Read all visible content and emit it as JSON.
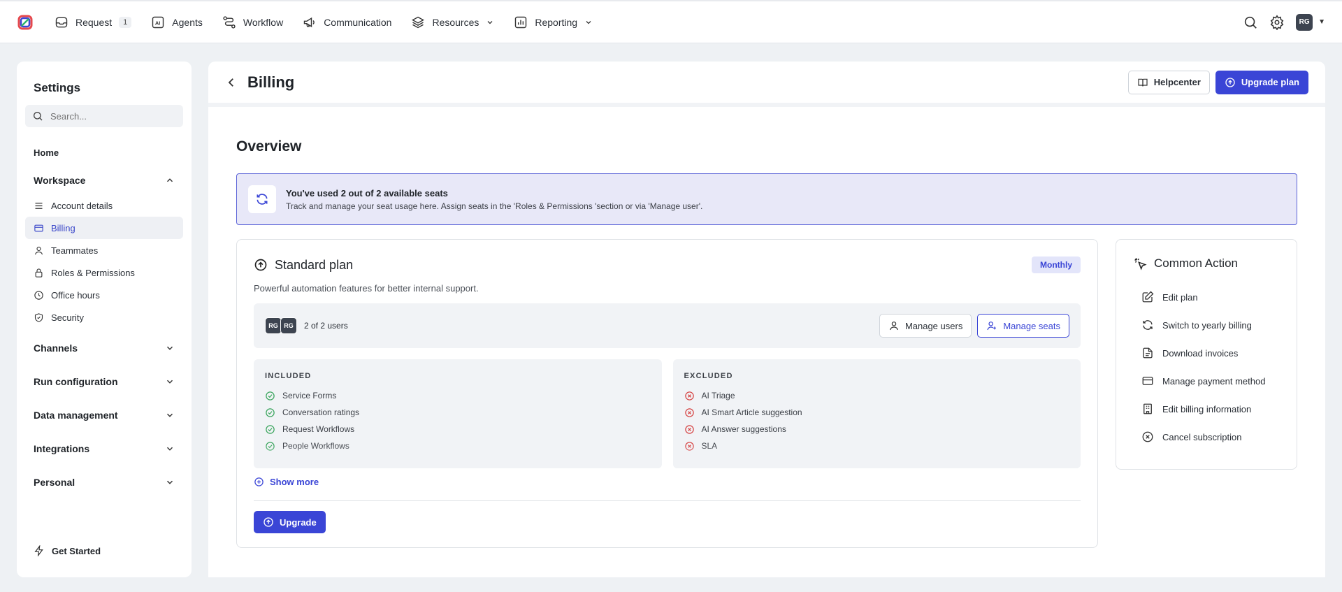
{
  "nav": {
    "items": [
      {
        "label": "Request",
        "icon": "inbox-icon",
        "badge": "1"
      },
      {
        "label": "Agents",
        "icon": "ai-icon"
      },
      {
        "label": "Workflow",
        "icon": "workflow-icon"
      },
      {
        "label": "Communication",
        "icon": "megaphone-icon"
      },
      {
        "label": "Resources",
        "icon": "layers-icon"
      },
      {
        "label": "Reporting",
        "icon": "chart-icon"
      }
    ],
    "avatar_initials": "RG"
  },
  "sidebar": {
    "title": "Settings",
    "search_placeholder": "Search...",
    "home_label": "Home",
    "workspace": {
      "label": "Workspace",
      "items": [
        {
          "label": "Account details",
          "icon": "list-icon"
        },
        {
          "label": "Billing",
          "icon": "credit-card-icon",
          "active": true
        },
        {
          "label": "Teammates",
          "icon": "user-icon"
        },
        {
          "label": "Roles & Permissions",
          "icon": "lock-icon"
        },
        {
          "label": "Office hours",
          "icon": "clock-icon"
        },
        {
          "label": "Security",
          "icon": "shield-icon"
        }
      ]
    },
    "sections": [
      "Channels",
      "Run configuration",
      "Data management",
      "Integrations",
      "Personal"
    ],
    "footer_label": "Get Started"
  },
  "header": {
    "title": "Billing",
    "helpcenter_label": "Helpcenter",
    "upgrade_plan_label": "Upgrade plan"
  },
  "overview": {
    "title": "Overview",
    "banner_title": "You've used 2 out of 2 available seats",
    "banner_desc": "Track and manage your seat usage here. Assign seats in the 'Roles & Permissions 'section or via 'Manage user'."
  },
  "plan": {
    "name": "Standard plan",
    "billing_cycle": "Monthly",
    "description": "Powerful automation features for better internal support.",
    "avatars": [
      "RG",
      "RG"
    ],
    "users_count": "2 of 2 users",
    "manage_users_label": "Manage users",
    "manage_seats_label": "Manage seats",
    "included_label": "INCLUDED",
    "included": [
      "Service Forms",
      "Conversation ratings",
      "Request Workflows",
      "People Workflows"
    ],
    "excluded_label": "EXCLUDED",
    "excluded": [
      "AI Triage",
      "AI Smart Article suggestion",
      "AI Answer suggestions",
      "SLA"
    ],
    "show_more_label": "Show more",
    "upgrade_label": "Upgrade"
  },
  "common_action": {
    "title": "Common Action",
    "items": [
      {
        "label": "Edit plan",
        "icon": "edit-icon"
      },
      {
        "label": "Switch to yearly billing",
        "icon": "refresh-icon"
      },
      {
        "label": "Download invoices",
        "icon": "document-icon"
      },
      {
        "label": "Manage payment method",
        "icon": "credit-card-icon"
      },
      {
        "label": "Edit billing information",
        "icon": "building-icon"
      },
      {
        "label": "Cancel subscription",
        "icon": "x-circle-icon"
      }
    ]
  },
  "colors": {
    "accent": "#3a45d6",
    "included_check": "#3aa55d",
    "excluded_x": "#d64545"
  }
}
